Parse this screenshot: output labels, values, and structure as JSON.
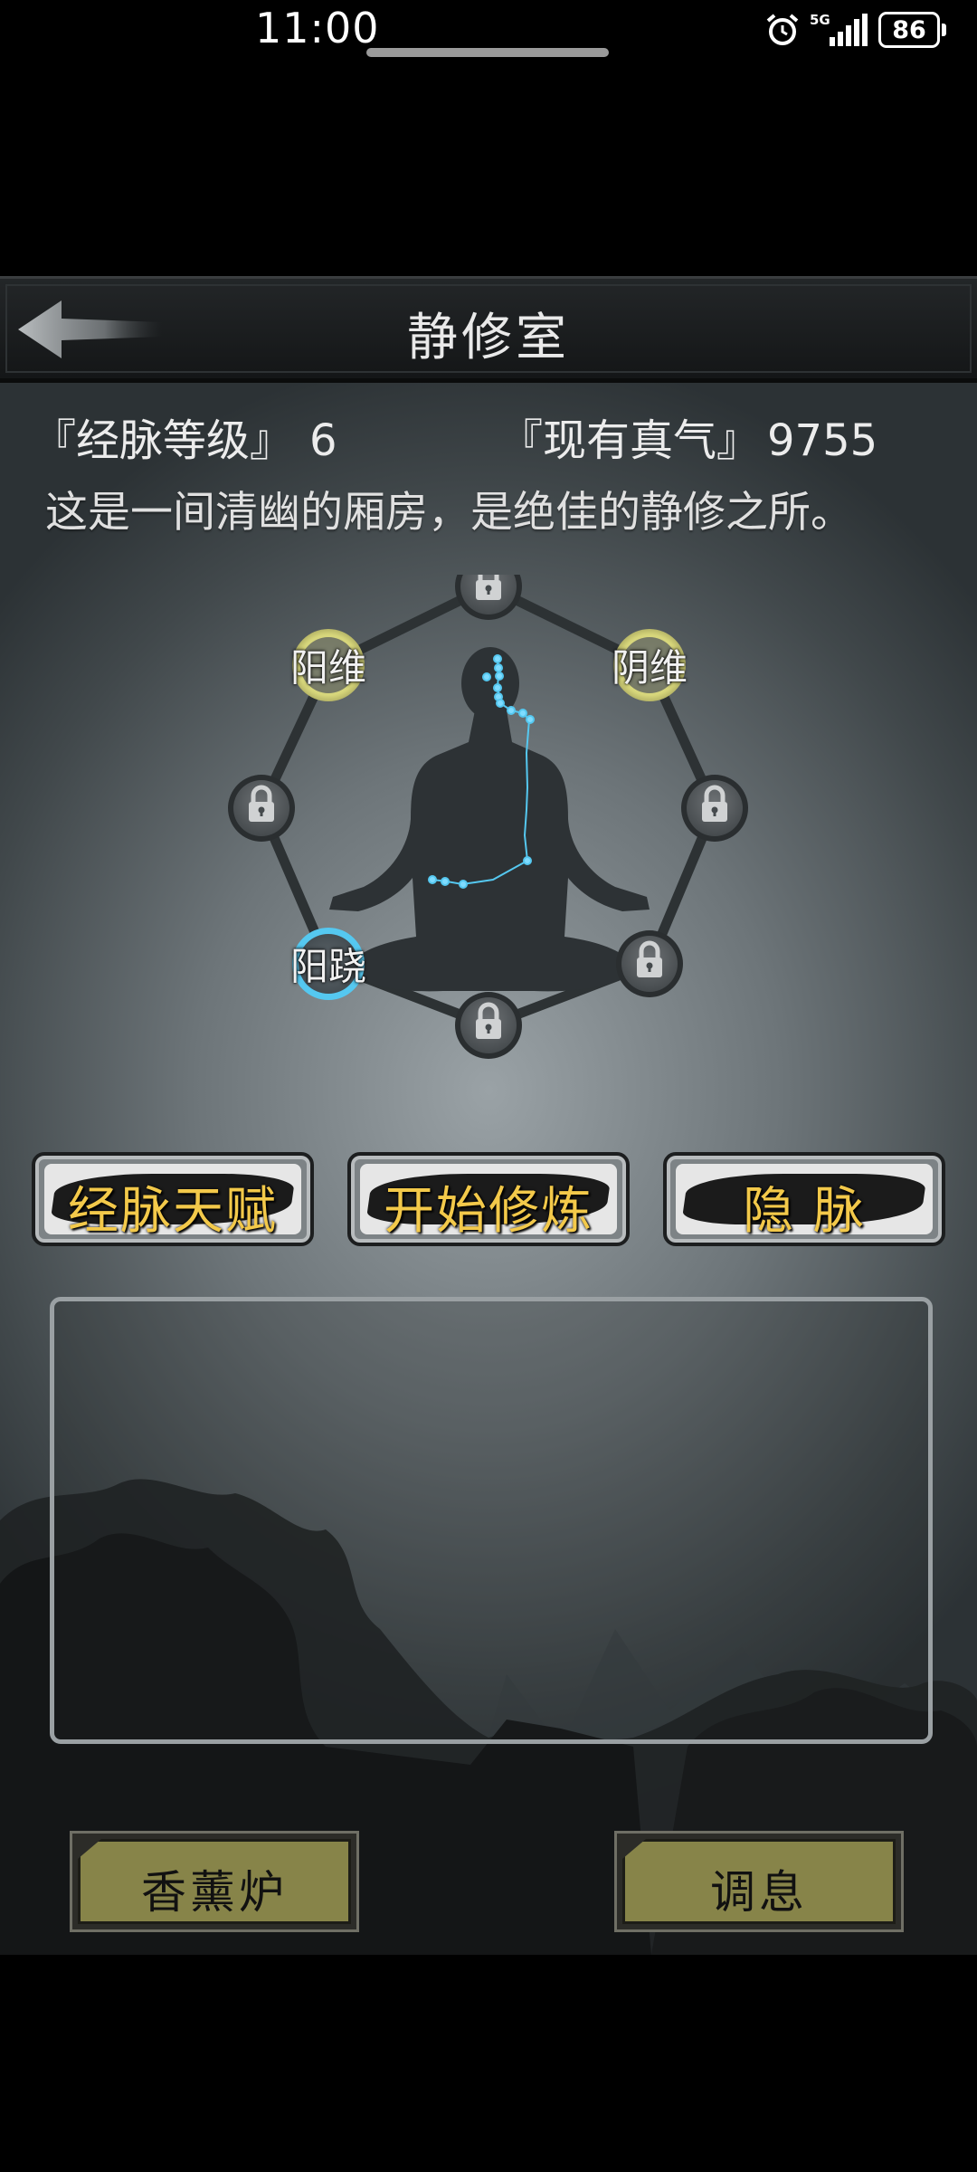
{
  "status_bar": {
    "time": "11:00",
    "network": "5G",
    "battery": "86"
  },
  "header": {
    "title": "静修室"
  },
  "stats": {
    "level_label": "『经脉等级』",
    "level_value": "6",
    "qi_label": "『现有真气』",
    "qi_value": "9755"
  },
  "description": "这是一间清幽的厢房，是绝佳的静修之所。",
  "meridian": {
    "nodes": [
      {
        "id": "top",
        "state": "locked"
      },
      {
        "id": "upper-left",
        "label": "阳维",
        "state": "unlocked"
      },
      {
        "id": "upper-right",
        "label": "阴维",
        "state": "unlocked"
      },
      {
        "id": "left",
        "state": "locked"
      },
      {
        "id": "right",
        "state": "locked"
      },
      {
        "id": "lower-left",
        "label": "阳跷",
        "state": "active"
      },
      {
        "id": "lower-right",
        "state": "locked"
      },
      {
        "id": "bottom",
        "state": "locked"
      }
    ]
  },
  "actions": {
    "talent": "经脉天赋",
    "start": "开始修炼",
    "hidden": "隐 脉"
  },
  "bottom": {
    "incense": "香薰炉",
    "rest": "调息"
  },
  "colors": {
    "accent_gold": "#f3c94a",
    "active_blue": "#55c8f0",
    "unlocked_yellow": "#d6d57a",
    "button_olive": "#878449"
  }
}
